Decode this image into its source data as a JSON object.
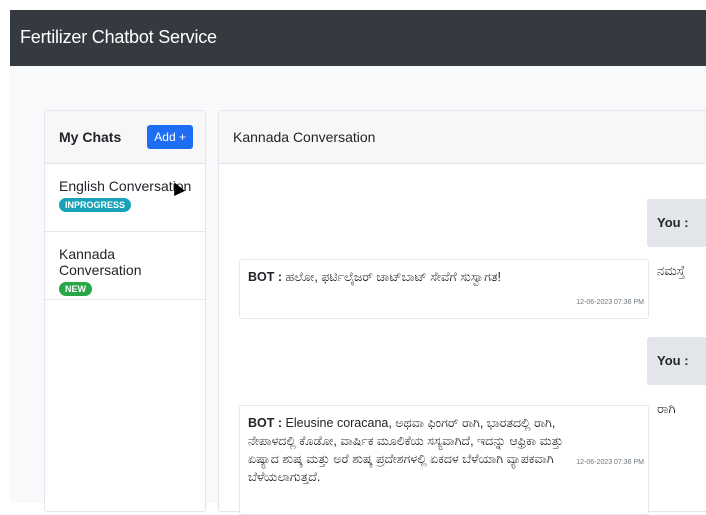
{
  "navbar": {
    "title": "Fertilizer Chatbot Service"
  },
  "sidebar": {
    "title": "My Chats",
    "add_label": "Add +",
    "chats": [
      {
        "name": "English Conversation",
        "status": "INPROGRESS"
      },
      {
        "name": "Kannada Conversation",
        "status": "NEW"
      }
    ]
  },
  "conversation": {
    "title": "Kannada Conversation",
    "messages": [
      {
        "sender": "You :",
        "text": "ನಮಸ್ತೆ"
      },
      {
        "sender": "BOT :",
        "text": "ಹಲೋ, ಫರ್ಟಿಲೈಜರ್ ಚಾಟ್‌ಬಾಟ್ ಸೇವೆಗೆ ಸುಸ್ವಾಗತ!",
        "time": "12-06-2023 07:36 PM"
      },
      {
        "sender": "You :",
        "text": "ರಾಗಿ"
      },
      {
        "sender": "BOT :",
        "text": "Eleusine coracana, ಅಥವಾ ಫಿಂಗರ್ ರಾಗಿ, ಭಾರತದಲ್ಲಿ ರಾಗಿ, ನೇಪಾಳದಲ್ಲಿ ಕೊಡೋ, ವಾರ್ಷಿಕ ಮೂಲಿಕೆಯ ಸಸ್ಯವಾಗಿದೆ, ಇದನ್ನು ಆಫ್ರಿಕಾ ಮತ್ತು ಏಷ್ಯಾದ ಶುಷ್ಕ ಮತ್ತು ಅರೆ ಶುಷ್ಕ ಪ್ರದೇಶಗಳಲ್ಲಿ ಏಕದಳ ಬೆಳೆಯಾಗಿ ವ್ಯಾಪಕವಾಗಿ ಬೆಳೆಯಲಾಗುತ್ತದೆ.",
        "time": "12-06-2023 07:36 PM"
      }
    ]
  }
}
